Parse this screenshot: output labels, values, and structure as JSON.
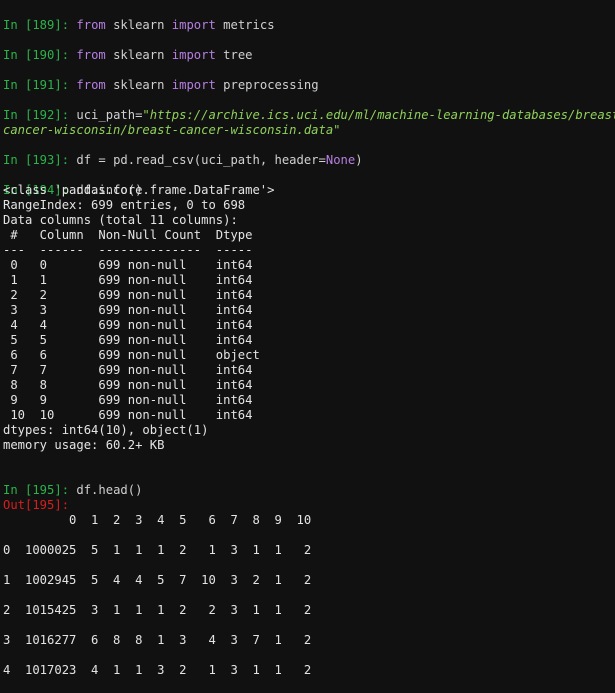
{
  "cells": [
    {
      "prompt": "In [189]:",
      "kw1": "from",
      "mod": " sklearn ",
      "kw2": "import",
      "name": " metrics"
    },
    {
      "prompt": "In [190]:",
      "kw1": "from",
      "mod": " sklearn ",
      "kw2": "import",
      "name": " tree"
    },
    {
      "prompt": "In [191]:",
      "kw1": "from",
      "mod": " sklearn ",
      "kw2": "import",
      "name": " preprocessing"
    }
  ],
  "cell192": {
    "prompt": "In [192]:",
    "code_prefix": " uci_path=",
    "str_line1": "\"https://archive.ics.uci.edu/ml/machine-learning-databases/breast-",
    "str_line2": "cancer-wisconsin/breast-cancer-wisconsin.data\""
  },
  "cell193": {
    "prompt": "In [193]:",
    "code_prefix": " df = pd.read_csv(uci_path, header=",
    "none_kw": "None",
    "code_suffix": ")"
  },
  "cell194": {
    "prompt": "In [194]:",
    "code": " df.info()",
    "output_lines": [
      "<class 'pandas.core.frame.DataFrame'>",
      "RangeIndex: 699 entries, 0 to 698",
      "Data columns (total 11 columns):",
      " #   Column  Non-Null Count  Dtype ",
      "---  ------  --------------  ----- ",
      " 0   0       699 non-null    int64 ",
      " 1   1       699 non-null    int64 ",
      " 2   2       699 non-null    int64 ",
      " 3   3       699 non-null    int64 ",
      " 4   4       699 non-null    int64 ",
      " 5   5       699 non-null    int64 ",
      " 6   6       699 non-null    object",
      " 7   7       699 non-null    int64 ",
      " 8   8       699 non-null    int64 ",
      " 9   9       699 non-null    int64 ",
      " 10  10      699 non-null    int64 ",
      "dtypes: int64(10), object(1)",
      "memory usage: 60.2+ KB"
    ]
  },
  "cell195": {
    "prompt": "In [195]:",
    "code": " df.head()",
    "out_prompt": "Out[195]:",
    "table": {
      "header": "         0  1  2  3  4  5   6  7  8  9  10",
      "rows": [
        "0  1000025  5  1  1  1  2   1  3  1  1   2",
        "1  1002945  5  4  4  5  7  10  3  2  1   2",
        "2  1015425  3  1  1  1  2   2  3  1  1   2",
        "3  1016277  6  8  8  1  3   4  3  7  1   2",
        "4  1017023  4  1  1  3  2   1  3  1  1   2"
      ]
    }
  },
  "colors": {
    "background": "#111111",
    "prompt_in": "#2bb34a",
    "prompt_out": "#d81e1e",
    "keyword": "#b67fe0",
    "string": "#8fd15a",
    "text": "#d0d0d0"
  }
}
